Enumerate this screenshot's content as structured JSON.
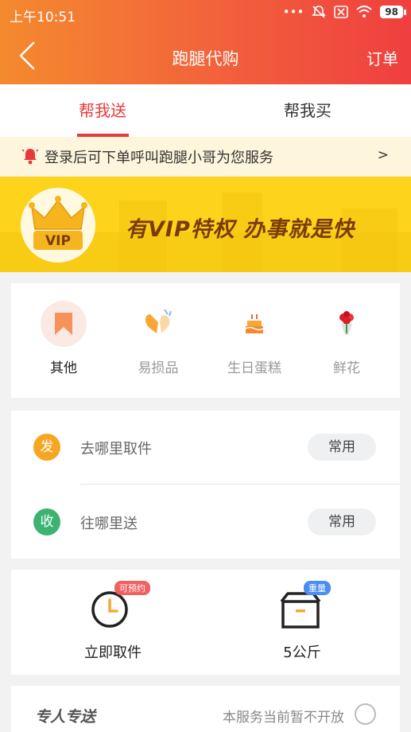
{
  "status_bar": {
    "time": "上午10:51",
    "battery": "98"
  },
  "nav": {
    "title": "跑腿代购",
    "orders_label": "订单"
  },
  "tabs": [
    {
      "label": "帮我送",
      "active": true
    },
    {
      "label": "帮我买",
      "active": false
    }
  ],
  "notice": {
    "text": "登录后可下单呼叫跑腿小哥为您服务",
    "arrow": ">"
  },
  "banner": {
    "slogan": "有VIP特权  办事就是快",
    "badge_text": "VIP"
  },
  "categories": [
    {
      "label": "其他",
      "icon": "bookmark-icon",
      "selected": true
    },
    {
      "label": "易损品",
      "icon": "fragile-heart-icon",
      "selected": false
    },
    {
      "label": "生日蛋糕",
      "icon": "cake-icon",
      "selected": false
    },
    {
      "label": "鲜花",
      "icon": "flower-icon",
      "selected": false
    }
  ],
  "addresses": [
    {
      "badge": "发",
      "placeholder": "去哪里取件",
      "button": "常用",
      "color": "#f5a623"
    },
    {
      "badge": "收",
      "placeholder": "往哪里送",
      "button": "常用",
      "color": "#3cb371"
    }
  ],
  "options": [
    {
      "label": "立即取件",
      "tag": "可预约",
      "icon": "clock-icon",
      "tag_color": "#f06060"
    },
    {
      "label": "5公斤",
      "tag": "重量",
      "icon": "box-icon",
      "tag_color": "#4a8ef0"
    }
  ],
  "special": {
    "title": "专人专送",
    "note": "本服务当前暂不开放"
  },
  "colors": {
    "accent": "#e8393a",
    "header_start": "#f48a2e",
    "header_end": "#ef3f3f",
    "banner": "#fdd31c"
  }
}
